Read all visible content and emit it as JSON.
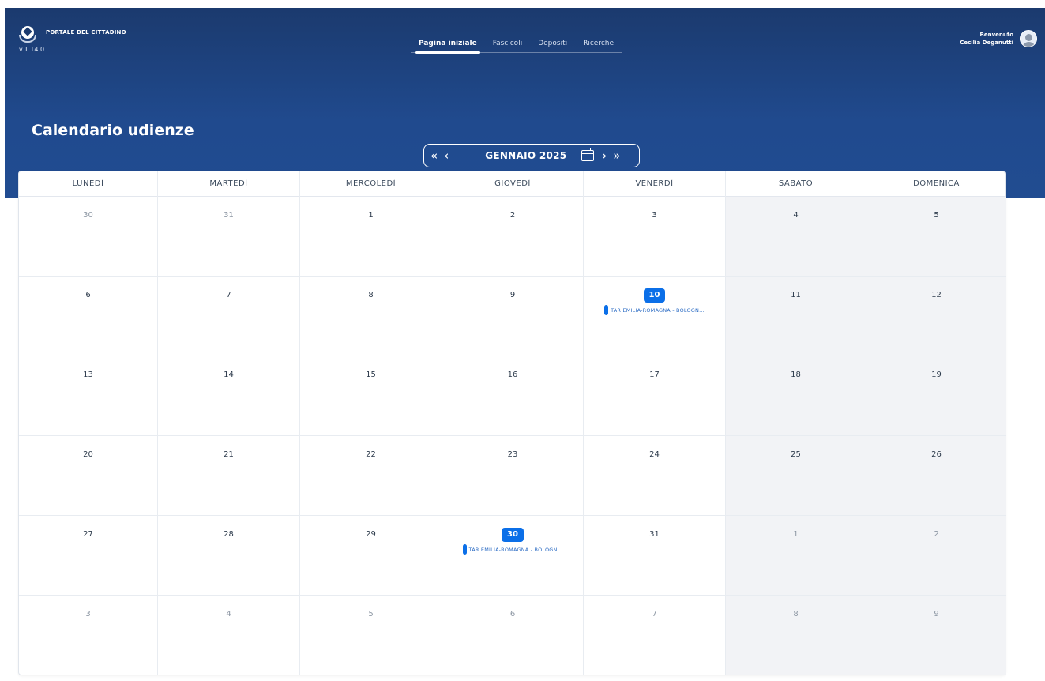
{
  "header": {
    "brand_title": "PORTALE DEL CITTADINO",
    "version": "v.1.14.0",
    "nav": [
      "Pagina iniziale",
      "Fascicoli",
      "Depositi",
      "Ricerche"
    ],
    "active_nav": "Pagina iniziale",
    "user_greeting": "Benvenuto",
    "user_name": "Cecilia Deganutti"
  },
  "page": {
    "title": "Calendario udienze",
    "month_label": "GENNAIO 2025",
    "nav_buttons": {
      "first": "«",
      "prev": "‹",
      "next": "›",
      "last": "»"
    }
  },
  "calendar": {
    "weekdays": [
      "LUNEDÌ",
      "MARTEDÌ",
      "MERCOLEDÌ",
      "GIOVEDÌ",
      "VENERDÌ",
      "SABATO",
      "DOMENICA"
    ],
    "weeks": [
      [
        {
          "day": "30",
          "other": true
        },
        {
          "day": "31",
          "other": true
        },
        {
          "day": "1"
        },
        {
          "day": "2"
        },
        {
          "day": "3"
        },
        {
          "day": "4"
        },
        {
          "day": "5"
        }
      ],
      [
        {
          "day": "6"
        },
        {
          "day": "7"
        },
        {
          "day": "8"
        },
        {
          "day": "9"
        },
        {
          "day": "10",
          "event": "TAR EMILIA-ROMAGNA - BOLOGN..."
        },
        {
          "day": "11"
        },
        {
          "day": "12"
        }
      ],
      [
        {
          "day": "13"
        },
        {
          "day": "14"
        },
        {
          "day": "15"
        },
        {
          "day": "16"
        },
        {
          "day": "17"
        },
        {
          "day": "18"
        },
        {
          "day": "19"
        }
      ],
      [
        {
          "day": "20"
        },
        {
          "day": "21"
        },
        {
          "day": "22"
        },
        {
          "day": "23"
        },
        {
          "day": "24"
        },
        {
          "day": "25"
        },
        {
          "day": "26"
        }
      ],
      [
        {
          "day": "27"
        },
        {
          "day": "28"
        },
        {
          "day": "29"
        },
        {
          "day": "30",
          "event": "TAR EMILIA-ROMAGNA - BOLOGN..."
        },
        {
          "day": "31"
        },
        {
          "day": "1",
          "other": true
        },
        {
          "day": "2",
          "other": true
        }
      ],
      [
        {
          "day": "3",
          "other": true
        },
        {
          "day": "4",
          "other": true
        },
        {
          "day": "5",
          "other": true
        },
        {
          "day": "6",
          "other": true
        },
        {
          "day": "7",
          "other": true
        },
        {
          "day": "8",
          "other": true
        },
        {
          "day": "9",
          "other": true
        }
      ]
    ]
  },
  "colors": {
    "header_bg": "#1b3a6e",
    "accent": "#0b6fe8",
    "weekend_bg": "#f2f3f6"
  }
}
